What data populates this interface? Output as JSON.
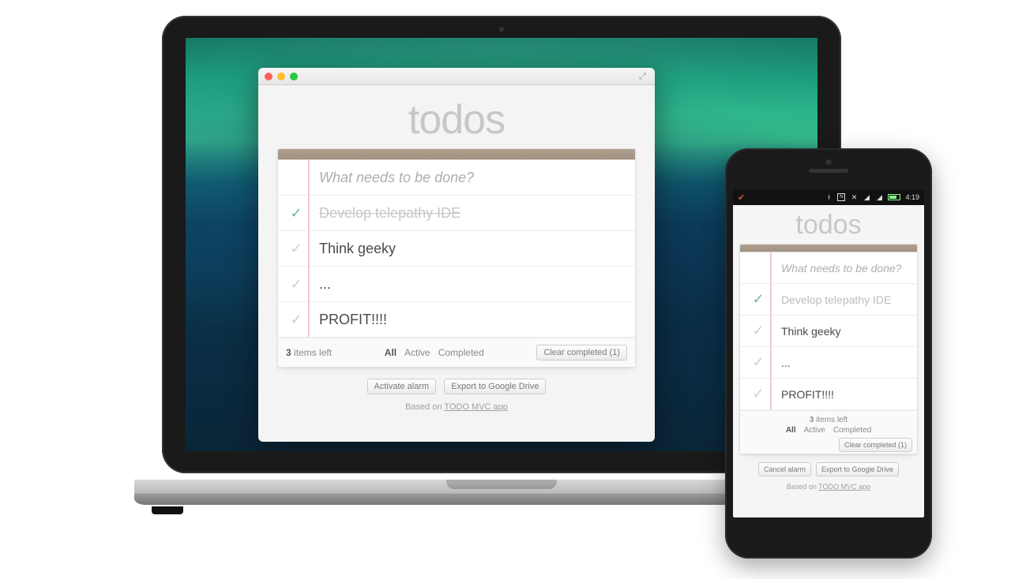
{
  "desktop": {
    "title": "todos",
    "input_placeholder": "What needs to be done?",
    "items": [
      {
        "text": "Develop telepathy IDE",
        "completed": true
      },
      {
        "text": "Think geeky",
        "completed": false
      },
      {
        "text": "...",
        "completed": false
      },
      {
        "text": "PROFIT!!!!",
        "completed": false
      }
    ],
    "footer": {
      "count_num": "3",
      "count_label": " items left",
      "filters": {
        "all": "All",
        "active": "Active",
        "completed": "Completed"
      },
      "clear_completed": "Clear completed (1)"
    },
    "actions": {
      "alarm": "Activate alarm",
      "export": "Export to Google Drive"
    },
    "credit_prefix": "Based on ",
    "credit_link": "TODO MVC app"
  },
  "phone": {
    "status": {
      "time": "4:19"
    },
    "title": "todos",
    "input_placeholder": "What needs to be done?",
    "items": [
      {
        "text": "Develop telepathy IDE",
        "completed": true
      },
      {
        "text": "Think geeky",
        "completed": false
      },
      {
        "text": "...",
        "completed": false
      },
      {
        "text": "PROFIT!!!!",
        "completed": false
      }
    ],
    "footer": {
      "count_num": "3",
      "count_label": " items left",
      "filters": {
        "all": "All",
        "active": "Active",
        "completed": "Completed"
      },
      "clear_completed": "Clear completed (1)"
    },
    "actions": {
      "alarm": "Cancel alarm",
      "export": "Export to Google Drive"
    },
    "credit_prefix": "Based on ",
    "credit_link": "TODO MVC app"
  }
}
